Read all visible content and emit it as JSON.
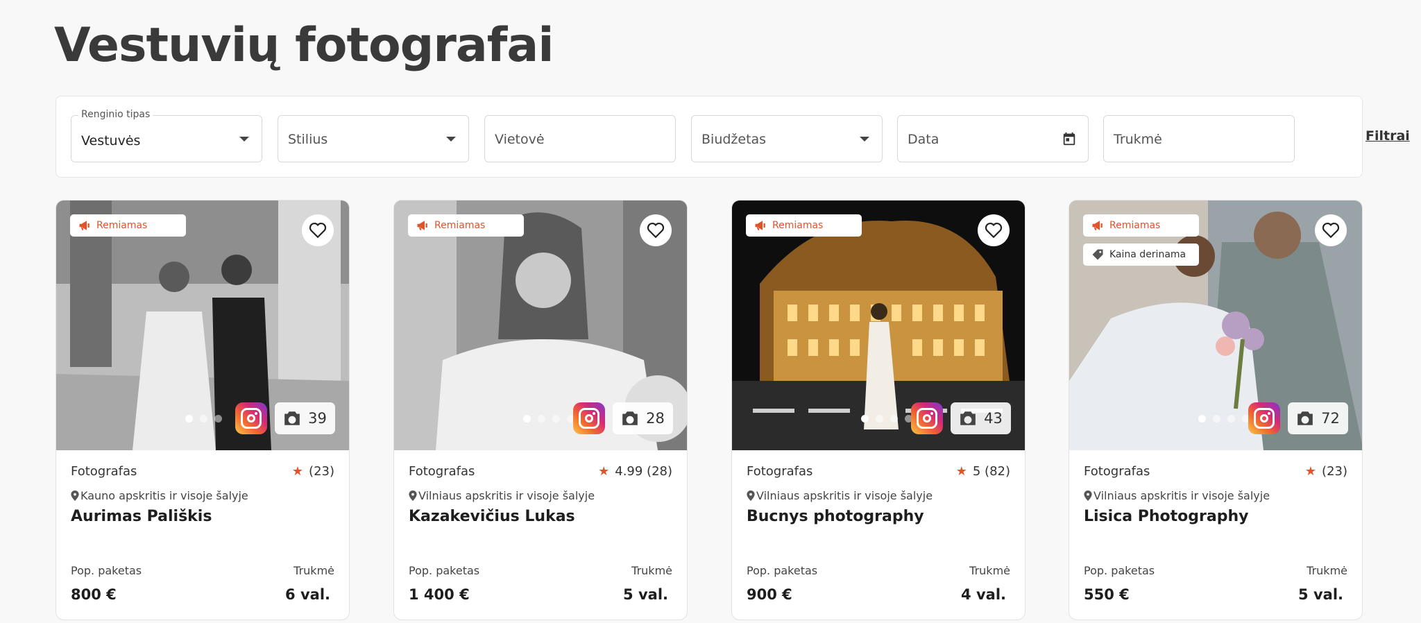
{
  "page": {
    "title": "Vestuvių fotografai"
  },
  "filters": {
    "event_type": {
      "label": "Renginio tipas",
      "value": "Vestuvės"
    },
    "style": {
      "placeholder": "Stilius"
    },
    "location": {
      "placeholder": "Vietovė"
    },
    "budget": {
      "placeholder": "Biudžetas"
    },
    "date": {
      "placeholder": "Data"
    },
    "duration": {
      "placeholder": "Trukmė"
    },
    "more_label": "Filtrai"
  },
  "cards": [
    {
      "badge": "Remiamas",
      "badge2": "",
      "photo_count": "39",
      "type": "Fotografas",
      "rating": "(23)",
      "location": "Kauno apskritis ir visoje šalyje",
      "name": "Aurimas Pališkis",
      "package_label": "Pop. paketas",
      "price": "800 €",
      "duration_label": "Trukmė",
      "duration": "6 val."
    },
    {
      "badge": "Remiamas",
      "badge2": "",
      "photo_count": "28",
      "type": "Fotografas",
      "rating": "4.99 (28)",
      "location": "Vilniaus apskritis ir visoje šalyje",
      "name": "Kazakevičius Lukas",
      "package_label": "Pop. paketas",
      "price": "1 400 €",
      "duration_label": "Trukmė",
      "duration": "5 val."
    },
    {
      "badge": "Remiamas",
      "badge2": "",
      "photo_count": "43",
      "type": "Fotografas",
      "rating": "5 (82)",
      "location": "Vilniaus apskritis ir visoje šalyje",
      "name": "Bucnys photography",
      "package_label": "Pop. paketas",
      "price": "900 €",
      "duration_label": "Trukmė",
      "duration": "4 val."
    },
    {
      "badge": "Remiamas",
      "badge2": "Kaina derinama",
      "photo_count": "72",
      "type": "Fotografas",
      "rating": "(23)",
      "location": "Vilniaus apskritis ir visoje šalyje",
      "name": "Lisica Photography",
      "package_label": "Pop. paketas",
      "price": "550 €",
      "duration_label": "Trukmė",
      "duration": "5 val."
    }
  ],
  "colors": {
    "accent": "#e0532b",
    "background": "#f8f8f8"
  },
  "icons": [
    "megaphone-icon",
    "tag-icon",
    "heart-icon",
    "instagram-icon",
    "camera-icon",
    "star-icon",
    "location-pin-icon",
    "calendar-icon",
    "caret-down-icon"
  ]
}
